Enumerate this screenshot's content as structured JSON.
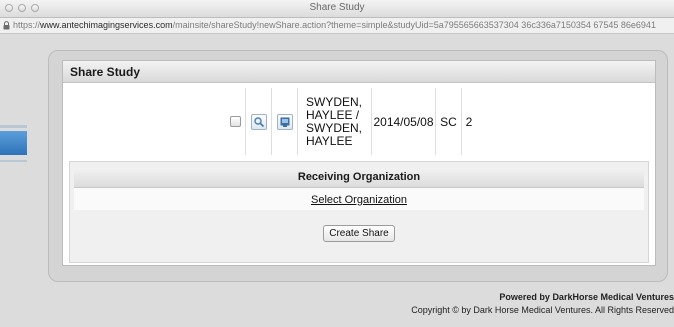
{
  "window": {
    "title": "Share Study"
  },
  "urlbar": {
    "scheme": "https://",
    "host": "www.antechimagingservices.com",
    "path": "/mainsite/shareStudy!newShare.action?theme=simple&studyUid=5a795565663537304 36c336a7150354 67545 86e6941"
  },
  "dialog": {
    "title": "Share Study",
    "study": {
      "name": "SWYDEN, HAYLEE / SWYDEN, HAYLEE",
      "date": "2014/05/08",
      "modality": "SC",
      "count": "2"
    },
    "receiving": {
      "header": "Receiving Organization",
      "select_label": "Select Organization"
    },
    "create_label": "Create Share"
  },
  "footer": {
    "powered": "Powered by DarkHorse Medical Ventures",
    "copyright": "Copyright © by Dark Horse Medical Ventures. All Rights Reserved"
  },
  "icons": {
    "window_close": "close-icon",
    "window_minimize": "minimize-icon",
    "window_zoom": "zoom-window-icon",
    "url_lock": "lock-icon",
    "study_zoom": "magnifier-icon",
    "study_preview": "image-preview-icon"
  },
  "colors": {
    "accent_blue": "#2e73b8"
  }
}
